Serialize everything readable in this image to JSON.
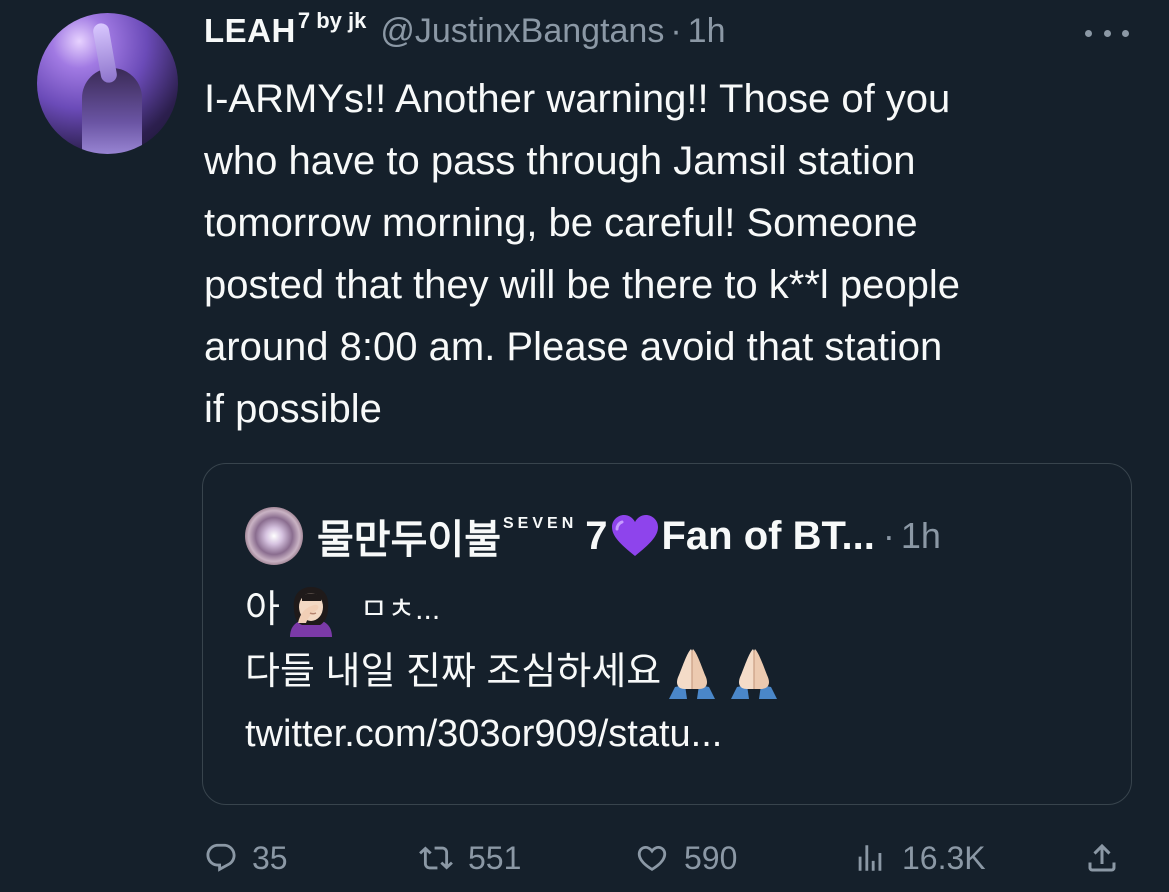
{
  "tweet": {
    "display_name": "LEAH",
    "name_suffix": "7 by jk",
    "handle": "@JustinxBangtans",
    "separator": "·",
    "time": "1h",
    "text_lines": [
      "I-ARMYs!! Another warning!! Those of you",
      "who have to pass through Jamsil station",
      "tomorrow morning, be careful! Someone",
      "posted that they will be there to k**l people",
      "around 8:00 am. Please avoid that station",
      "if possible"
    ]
  },
  "quote": {
    "display_name": "물만두이불",
    "name_suffix": "SEVEN",
    "name_part2": "7",
    "name_part3": "Fan of BT...",
    "separator": "·",
    "time": "1h",
    "line1_prefix": "아",
    "line1_suffix": "ㅁㅊ...",
    "line2": "다들 내일 진짜 조심하세요",
    "line3": "twitter.com/303or909/statu..."
  },
  "actions": {
    "replies": "35",
    "retweets": "551",
    "likes": "590",
    "views": "16.3K"
  },
  "icons": {
    "reply": "reply-icon",
    "retweet": "retweet-icon",
    "like": "heart-outline-icon",
    "views": "analytics-icon",
    "share": "share-icon",
    "more": "more-dots-icon"
  },
  "colors": {
    "background": "#15202b",
    "text": "#f7f9f9",
    "secondary": "#8b98a5",
    "border": "#38444d",
    "purple_heart": "#8e44ec"
  }
}
